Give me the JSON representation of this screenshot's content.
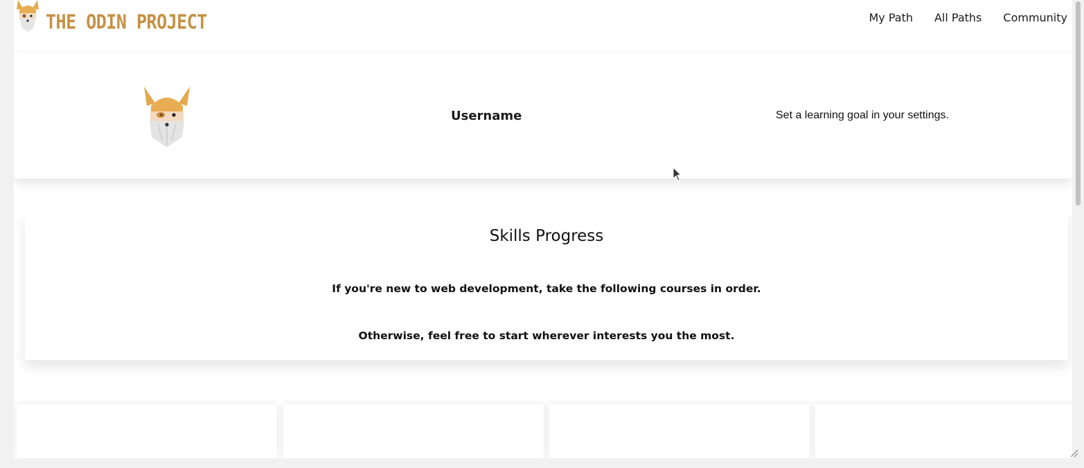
{
  "brand": {
    "name": "THE ODIN PROJECT",
    "logo_icon": "odin-viking-head-icon",
    "accent_color": "#c59143"
  },
  "nav": {
    "links": [
      {
        "label": "My Path"
      },
      {
        "label": "All Paths"
      },
      {
        "label": "Community"
      }
    ]
  },
  "profile": {
    "avatar_icon": "odin-viking-head-icon",
    "username": "Username",
    "goal_text": "Set a learning goal in your settings."
  },
  "skills": {
    "title": "Skills Progress",
    "line1": "If you're new to web development, take the following courses in order.",
    "line2": "Otherwise, feel free to start wherever interests you the most."
  },
  "courses": [
    {
      "label": ""
    },
    {
      "label": ""
    },
    {
      "label": ""
    },
    {
      "label": ""
    }
  ]
}
